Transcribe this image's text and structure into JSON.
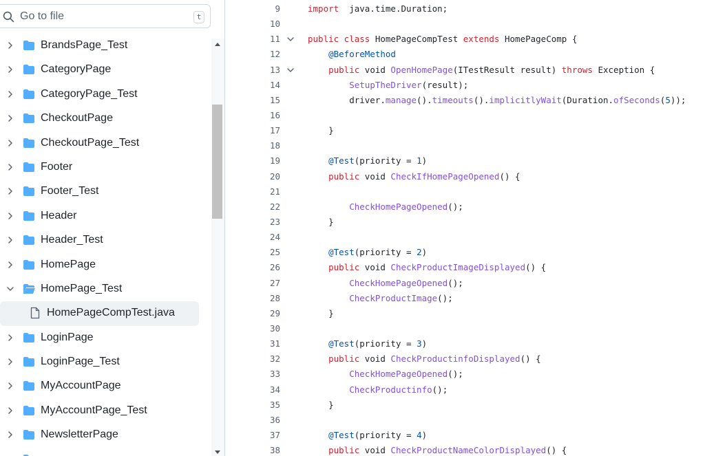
{
  "search": {
    "placeholder": "Go to file",
    "shortcut": "t"
  },
  "tree": [
    {
      "type": "folder",
      "label": "BrandsPage_Test",
      "expanded": false
    },
    {
      "type": "folder",
      "label": "CategoryPage",
      "expanded": false
    },
    {
      "type": "folder",
      "label": "CategoryPage_Test",
      "expanded": false
    },
    {
      "type": "folder",
      "label": "CheckoutPage",
      "expanded": false
    },
    {
      "type": "folder",
      "label": "CheckoutPage_Test",
      "expanded": false
    },
    {
      "type": "folder",
      "label": "Footer",
      "expanded": false
    },
    {
      "type": "folder",
      "label": "Footer_Test",
      "expanded": false
    },
    {
      "type": "folder",
      "label": "Header",
      "expanded": false
    },
    {
      "type": "folder",
      "label": "Header_Test",
      "expanded": false
    },
    {
      "type": "folder",
      "label": "HomePage",
      "expanded": false
    },
    {
      "type": "folder",
      "label": "HomePage_Test",
      "expanded": true
    },
    {
      "type": "file",
      "label": "HomePageCompTest.java",
      "selected": true
    },
    {
      "type": "folder",
      "label": "LoginPage",
      "expanded": false
    },
    {
      "type": "folder",
      "label": "LoginPage_Test",
      "expanded": false
    },
    {
      "type": "folder",
      "label": "MyAccountPage",
      "expanded": false
    },
    {
      "type": "folder",
      "label": "MyAccountPage_Test",
      "expanded": false
    },
    {
      "type": "folder",
      "label": "NewsletterPage",
      "expanded": false
    },
    {
      "type": "folder",
      "label": "",
      "expanded": false
    }
  ],
  "colors": {
    "keyword": "#cf222e",
    "annotation": "#0550ae",
    "function": "#8250df",
    "folder": "#54aeff",
    "text": "#1f2328",
    "line_number": "#59636e"
  },
  "code_lines": [
    {
      "n": "9",
      "fold": false,
      "tokens": [
        [
          "k",
          "import"
        ],
        [
          "",
          "  java.time.Duration;"
        ]
      ]
    },
    {
      "n": "10",
      "fold": false,
      "tokens": []
    },
    {
      "n": "11",
      "fold": true,
      "tokens": [
        [
          "k",
          "public class"
        ],
        [
          "",
          " HomePageCompTest "
        ],
        [
          "k",
          "extends"
        ],
        [
          "",
          " HomePageComp {"
        ]
      ]
    },
    {
      "n": "12",
      "fold": false,
      "tokens": [
        [
          "",
          "    "
        ],
        [
          "a",
          "@BeforeMethod"
        ]
      ]
    },
    {
      "n": "13",
      "fold": true,
      "tokens": [
        [
          "",
          "    "
        ],
        [
          "k",
          "public"
        ],
        [
          "",
          " void "
        ],
        [
          "f",
          "OpenHomePage"
        ],
        [
          "",
          "(ITestResult result) "
        ],
        [
          "k",
          "throws"
        ],
        [
          "",
          " Exception {"
        ]
      ]
    },
    {
      "n": "14",
      "fold": false,
      "tokens": [
        [
          "",
          "        "
        ],
        [
          "f",
          "SetupTheDriver"
        ],
        [
          "",
          "(result);"
        ]
      ]
    },
    {
      "n": "15",
      "fold": false,
      "tokens": [
        [
          "",
          "        driver."
        ],
        [
          "f",
          "manage"
        ],
        [
          "",
          "()."
        ],
        [
          "f",
          "timeouts"
        ],
        [
          "",
          "()."
        ],
        [
          "f",
          "implicitlyWait"
        ],
        [
          "",
          "(Duration."
        ],
        [
          "f",
          "ofSeconds"
        ],
        [
          "",
          "("
        ],
        [
          "a",
          "5"
        ],
        [
          "",
          "));"
        ]
      ]
    },
    {
      "n": "16",
      "fold": false,
      "tokens": []
    },
    {
      "n": "17",
      "fold": false,
      "tokens": [
        [
          "",
          "    }"
        ]
      ]
    },
    {
      "n": "18",
      "fold": false,
      "tokens": []
    },
    {
      "n": "19",
      "fold": false,
      "tokens": [
        [
          "",
          "    "
        ],
        [
          "a",
          "@Test"
        ],
        [
          "",
          "(priority = "
        ],
        [
          "a",
          "1"
        ],
        [
          "",
          ")"
        ]
      ]
    },
    {
      "n": "20",
      "fold": false,
      "tokens": [
        [
          "",
          "    "
        ],
        [
          "k",
          "public"
        ],
        [
          "",
          " void "
        ],
        [
          "f",
          "CheckIfHomePageOpened"
        ],
        [
          "",
          "() {"
        ]
      ]
    },
    {
      "n": "21",
      "fold": false,
      "tokens": []
    },
    {
      "n": "22",
      "fold": false,
      "tokens": [
        [
          "",
          "        "
        ],
        [
          "f",
          "CheckHomePageOpened"
        ],
        [
          "",
          "();"
        ]
      ]
    },
    {
      "n": "23",
      "fold": false,
      "tokens": [
        [
          "",
          "    }"
        ]
      ]
    },
    {
      "n": "24",
      "fold": false,
      "tokens": []
    },
    {
      "n": "25",
      "fold": false,
      "tokens": [
        [
          "",
          "    "
        ],
        [
          "a",
          "@Test"
        ],
        [
          "",
          "(priority = "
        ],
        [
          "a",
          "2"
        ],
        [
          "",
          ")"
        ]
      ]
    },
    {
      "n": "26",
      "fold": false,
      "tokens": [
        [
          "",
          "    "
        ],
        [
          "k",
          "public"
        ],
        [
          "",
          " void "
        ],
        [
          "f",
          "CheckProductImageDisplayed"
        ],
        [
          "",
          "() {"
        ]
      ]
    },
    {
      "n": "27",
      "fold": false,
      "tokens": [
        [
          "",
          "        "
        ],
        [
          "f",
          "CheckHomePageOpened"
        ],
        [
          "",
          "();"
        ]
      ]
    },
    {
      "n": "28",
      "fold": false,
      "tokens": [
        [
          "",
          "        "
        ],
        [
          "f",
          "CheckProductImage"
        ],
        [
          "",
          "();"
        ]
      ]
    },
    {
      "n": "29",
      "fold": false,
      "tokens": [
        [
          "",
          "    }"
        ]
      ]
    },
    {
      "n": "30",
      "fold": false,
      "tokens": []
    },
    {
      "n": "31",
      "fold": false,
      "tokens": [
        [
          "",
          "    "
        ],
        [
          "a",
          "@Test"
        ],
        [
          "",
          "(priority = "
        ],
        [
          "a",
          "3"
        ],
        [
          "",
          ")"
        ]
      ]
    },
    {
      "n": "32",
      "fold": false,
      "tokens": [
        [
          "",
          "    "
        ],
        [
          "k",
          "public"
        ],
        [
          "",
          " void "
        ],
        [
          "f",
          "CheckProductinfoDisplayed"
        ],
        [
          "",
          "() {"
        ]
      ]
    },
    {
      "n": "33",
      "fold": false,
      "tokens": [
        [
          "",
          "        "
        ],
        [
          "f",
          "CheckHomePageOpened"
        ],
        [
          "",
          "();"
        ]
      ]
    },
    {
      "n": "34",
      "fold": false,
      "tokens": [
        [
          "",
          "        "
        ],
        [
          "f",
          "CheckProductinfo"
        ],
        [
          "",
          "();"
        ]
      ]
    },
    {
      "n": "35",
      "fold": false,
      "tokens": [
        [
          "",
          "    }"
        ]
      ]
    },
    {
      "n": "36",
      "fold": false,
      "tokens": []
    },
    {
      "n": "37",
      "fold": false,
      "tokens": [
        [
          "",
          "    "
        ],
        [
          "a",
          "@Test"
        ],
        [
          "",
          "(priority = "
        ],
        [
          "a",
          "4"
        ],
        [
          "",
          ")"
        ]
      ]
    },
    {
      "n": "38",
      "fold": false,
      "tokens": [
        [
          "",
          "    "
        ],
        [
          "k",
          "public"
        ],
        [
          "",
          " void "
        ],
        [
          "f",
          "CheckProductNameColorDisplayed"
        ],
        [
          "",
          "() {"
        ]
      ]
    }
  ]
}
